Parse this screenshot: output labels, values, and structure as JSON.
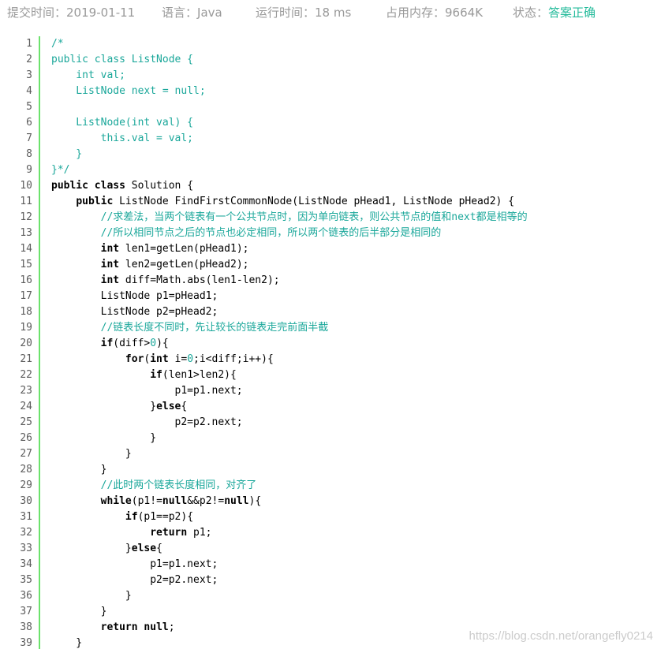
{
  "header": {
    "submit_time_label": "提交时间：",
    "submit_time": "2019-01-11",
    "language_label": "语言：",
    "language": "Java",
    "runtime_label": "运行时间：",
    "runtime": "18 ms",
    "memory_label": "占用内存：",
    "memory": "9664K",
    "status_label": "状态：",
    "status": "答案正确",
    "status_color": "#25bb9b"
  },
  "code_lines": [
    [
      [
        "c",
        "/*"
      ]
    ],
    [
      [
        "c",
        "public class ListNode {"
      ]
    ],
    [
      [
        "c",
        "    int val;"
      ]
    ],
    [
      [
        "c",
        "    ListNode next = null;"
      ]
    ],
    [],
    [
      [
        "c",
        "    ListNode(int val) {"
      ]
    ],
    [
      [
        "c",
        "        this.val = val;"
      ]
    ],
    [
      [
        "c",
        "    }"
      ]
    ],
    [
      [
        "c",
        "}*/"
      ]
    ],
    [
      [
        "k",
        "public class"
      ],
      [
        "p",
        " Solution {"
      ]
    ],
    [
      [
        "p",
        "    "
      ],
      [
        "k",
        "public"
      ],
      [
        "p",
        " ListNode FindFirstCommonNode(ListNode pHead1, ListNode pHead2) {"
      ]
    ],
    [
      [
        "c",
        "        //求差法，当两个链表有一个公共节点时，因为单向链表，则公共节点的值和next都是相等的"
      ]
    ],
    [
      [
        "c",
        "        //所以相同节点之后的节点也必定相同，所以两个链表的后半部分是相同的"
      ]
    ],
    [
      [
        "p",
        "        "
      ],
      [
        "k",
        "int"
      ],
      [
        "p",
        " len1=getLen(pHead1);"
      ]
    ],
    [
      [
        "p",
        "        "
      ],
      [
        "k",
        "int"
      ],
      [
        "p",
        " len2=getLen(pHead2);"
      ]
    ],
    [
      [
        "p",
        "        "
      ],
      [
        "k",
        "int"
      ],
      [
        "p",
        " diff=Math.abs(len1-len2);"
      ]
    ],
    [
      [
        "p",
        "        ListNode p1=pHead1;"
      ]
    ],
    [
      [
        "p",
        "        ListNode p2=pHead2;"
      ]
    ],
    [
      [
        "c",
        "        //链表长度不同时，先让较长的链表走完前面半截"
      ]
    ],
    [
      [
        "p",
        "        "
      ],
      [
        "k",
        "if"
      ],
      [
        "p",
        "(diff>"
      ],
      [
        "n",
        "0"
      ],
      [
        "p",
        "){"
      ]
    ],
    [
      [
        "p",
        "            "
      ],
      [
        "k",
        "for"
      ],
      [
        "p",
        "("
      ],
      [
        "k",
        "int"
      ],
      [
        "p",
        " i="
      ],
      [
        "n",
        "0"
      ],
      [
        "p",
        ";i<diff;i++){"
      ]
    ],
    [
      [
        "p",
        "                "
      ],
      [
        "k",
        "if"
      ],
      [
        "p",
        "(len1>len2){"
      ]
    ],
    [
      [
        "p",
        "                    p1=p1.next;"
      ]
    ],
    [
      [
        "p",
        "                }"
      ],
      [
        "k",
        "else"
      ],
      [
        "p",
        "{"
      ]
    ],
    [
      [
        "p",
        "                    p2=p2.next;"
      ]
    ],
    [
      [
        "p",
        "                }"
      ]
    ],
    [
      [
        "p",
        "            }"
      ]
    ],
    [
      [
        "p",
        "        }"
      ]
    ],
    [
      [
        "c",
        "        //此时两个链表长度相同，对齐了"
      ]
    ],
    [
      [
        "p",
        "        "
      ],
      [
        "k",
        "while"
      ],
      [
        "p",
        "(p1!="
      ],
      [
        "k",
        "null"
      ],
      [
        "p",
        "&&p2!="
      ],
      [
        "k",
        "null"
      ],
      [
        "p",
        "){"
      ]
    ],
    [
      [
        "p",
        "            "
      ],
      [
        "k",
        "if"
      ],
      [
        "p",
        "(p1==p2){"
      ]
    ],
    [
      [
        "p",
        "                "
      ],
      [
        "k",
        "return"
      ],
      [
        "p",
        " p1;"
      ]
    ],
    [
      [
        "p",
        "            }"
      ],
      [
        "k",
        "else"
      ],
      [
        "p",
        "{"
      ]
    ],
    [
      [
        "p",
        "                p1=p1.next;"
      ]
    ],
    [
      [
        "p",
        "                p2=p2.next;"
      ]
    ],
    [
      [
        "p",
        "            }"
      ]
    ],
    [
      [
        "p",
        "        }"
      ]
    ],
    [
      [
        "p",
        "        "
      ],
      [
        "k",
        "return"
      ],
      [
        "p",
        " "
      ],
      [
        "k",
        "null"
      ],
      [
        "p",
        ";"
      ]
    ],
    [
      [
        "p",
        "    }"
      ]
    ]
  ],
  "watermark": "https://blog.csdn.net/orangefly0214"
}
